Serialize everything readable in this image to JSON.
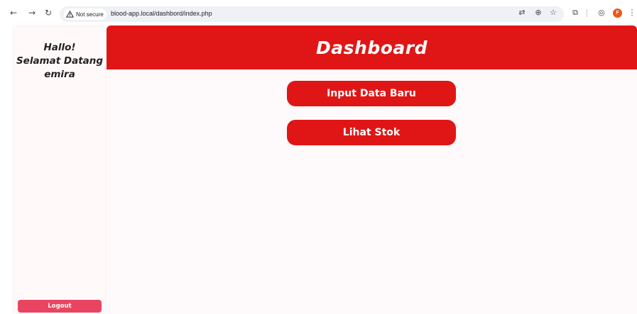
{
  "browser": {
    "security_label": "Not secure",
    "url": "blood-app.local/dashbord/index.php",
    "profile_initial": "F",
    "profile_color": "#e8591a"
  },
  "sidebar": {
    "greeting_line1": "Hallo!",
    "greeting_line2": "Selamat Datang",
    "username": "emira",
    "logout_label": "Logout"
  },
  "header": {
    "title": "Dashboard"
  },
  "actions": {
    "input_label": "Input Data Baru",
    "stock_label": "Lihat Stok"
  },
  "colors": {
    "brand_red": "#e01515",
    "logout_pink": "#ea4560"
  }
}
